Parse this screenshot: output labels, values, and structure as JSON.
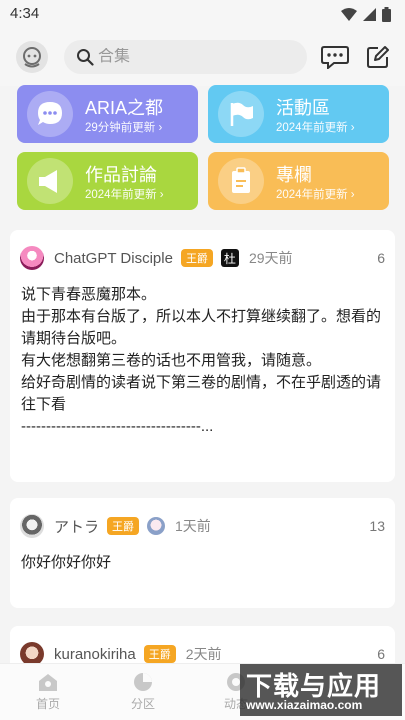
{
  "status": {
    "time": "4:34"
  },
  "search": {
    "placeholder": "合集"
  },
  "categories": [
    {
      "title": "ARIA之都",
      "subtitle": "29分钟前更新 ›",
      "color": "#8c8df0",
      "icon": "chat-bubble-icon"
    },
    {
      "title": "活動區",
      "subtitle": "2024年前更新 ›",
      "color": "#62c9f2",
      "icon": "flag-icon"
    },
    {
      "title": "作品討論",
      "subtitle": "2024年前更新 ›",
      "color": "#a9d73f",
      "icon": "megaphone-icon"
    },
    {
      "title": "專欄",
      "subtitle": "2024年前更新 ›",
      "color": "#f9bd56",
      "icon": "clipboard-icon"
    }
  ],
  "posts": [
    {
      "username": "ChatGPT Disciple",
      "badge": "王爵",
      "medal": "杜",
      "time": "29天前",
      "count": "6",
      "content": "说下青春恶魔那本。\n由于那本有台版了，所以本人不打算继续翻了。想看的请期待台版吧。\n有大佬想翻第三卷的话也不用管我，请随意。\n给好奇剧情的读者说下第三卷的剧情，不在乎剧透的请往下看\n------------------------------------..."
    },
    {
      "username": "アトラ",
      "badge": "王爵",
      "time": "1天前",
      "count": "13",
      "content": "你好你好你好"
    },
    {
      "username": "kuranokiriha",
      "badge": "王爵",
      "time": "2天前",
      "count": "6",
      "content": ""
    }
  ],
  "nav": [
    {
      "label": "首页",
      "icon": "home-icon"
    },
    {
      "label": "分区",
      "icon": "pie-chart-icon"
    },
    {
      "label": "动态",
      "icon": "activity-icon"
    }
  ],
  "watermark": {
    "line1": "下载与应用",
    "line2": "www.xiazaimao.com"
  }
}
